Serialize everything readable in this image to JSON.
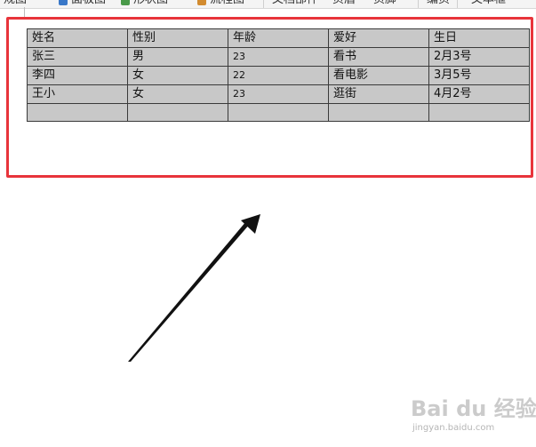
{
  "toolbar": {
    "items": [
      "规图",
      "面板图",
      "形状图",
      "流程图",
      "文档部件",
      "页眉",
      "页脚",
      "编页",
      "文本框"
    ]
  },
  "table": {
    "rows": [
      [
        "姓名",
        "性别",
        "年龄",
        "爱好",
        "生日"
      ],
      [
        "张三",
        "男",
        "23",
        "看书",
        "2月3号"
      ],
      [
        "李四",
        "女",
        "22",
        "看电影",
        "3月5号"
      ],
      [
        "王小",
        "女",
        "23",
        "逛街",
        "4月2号"
      ],
      [
        "",
        "",
        "",
        "",
        ""
      ]
    ]
  },
  "annotation": {
    "highlight_color": "#e8343b",
    "arrow_color": "#111111"
  },
  "watermark": {
    "logo": "Bai du 经验",
    "url": "jingyan.baidu.com"
  }
}
